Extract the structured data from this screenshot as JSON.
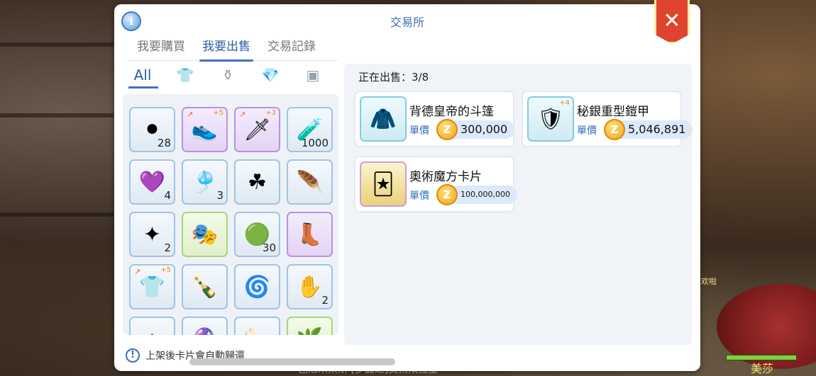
{
  "window": {
    "title": "交易所"
  },
  "tabs": [
    {
      "label": "我要購買"
    },
    {
      "label": "我要出售"
    },
    {
      "label": "交易記錄"
    }
  ],
  "categories": [
    {
      "label": "All",
      "icon": "all"
    },
    {
      "label": "",
      "icon": "armor-icon"
    },
    {
      "label": "",
      "icon": "potion-icon"
    },
    {
      "label": "",
      "icon": "gem-icon"
    },
    {
      "label": "",
      "icon": "card-icon"
    }
  ],
  "inventory": [
    {
      "icon": "stone",
      "glyph": "⚫",
      "qty": "28",
      "style": "blue"
    },
    {
      "icon": "pink-shoes",
      "glyph": "👟",
      "plus": "+5",
      "style": "purple"
    },
    {
      "icon": "spear",
      "glyph": "🗡",
      "plus": "+3",
      "style": "purple"
    },
    {
      "icon": "flask",
      "glyph": "🧪",
      "qty": "1000",
      "style": "blue"
    },
    {
      "icon": "purple-heart",
      "glyph": "💜",
      "qty": "4",
      "style": "blue"
    },
    {
      "icon": "cape",
      "glyph": "🎐",
      "qty": "3",
      "style": "blue"
    },
    {
      "icon": "clover",
      "glyph": "☘",
      "style": "blue"
    },
    {
      "icon": "feather-hook",
      "glyph": "🪶",
      "style": "blue"
    },
    {
      "icon": "crystal",
      "glyph": "✦",
      "qty": "2",
      "style": "blue"
    },
    {
      "icon": "mask",
      "glyph": "🎭",
      "style": "green"
    },
    {
      "icon": "green-orb",
      "glyph": "🟢",
      "qty": "30",
      "style": "blue"
    },
    {
      "icon": "boots",
      "glyph": "👢",
      "style": "purple"
    },
    {
      "icon": "chainmail",
      "glyph": "👕",
      "plus": "+5",
      "style": "blue"
    },
    {
      "icon": "green-potion",
      "glyph": "🍾",
      "style": "blue"
    },
    {
      "icon": "horn",
      "glyph": "🌀",
      "style": "blue"
    },
    {
      "icon": "glove",
      "glyph": "✋",
      "qty": "2",
      "style": "blue"
    },
    {
      "icon": "red-gem",
      "glyph": "🔺",
      "style": "blue"
    },
    {
      "icon": "purple-gem",
      "glyph": "🔮",
      "style": "blue"
    },
    {
      "icon": "claws",
      "glyph": "🦴",
      "style": "blue"
    },
    {
      "icon": "green-item",
      "glyph": "🌿",
      "style": "green"
    }
  ],
  "note": {
    "text": "上架後卡片會自動歸還"
  },
  "selling": {
    "label": "正在出售：3/8",
    "items": [
      {
        "name": "背德皇帝的斗篷",
        "unit_label": "單價",
        "price": "300,000",
        "glyph": "🧥"
      },
      {
        "name": "秘銀重型鎧甲",
        "unit_label": "單價",
        "price": "5,046,891",
        "glyph": "🛡",
        "plus": "+4"
      },
      {
        "name": "奧術魔方卡片",
        "unit_label": "單價",
        "price": "100,000,000",
        "glyph": "🃏"
      }
    ]
  },
  "background": {
    "npc_name": "美莎",
    "chat_fragment": "欢啦",
    "bottom_text": "巴尼米莱斯   [多面之]交扬双拉望"
  }
}
